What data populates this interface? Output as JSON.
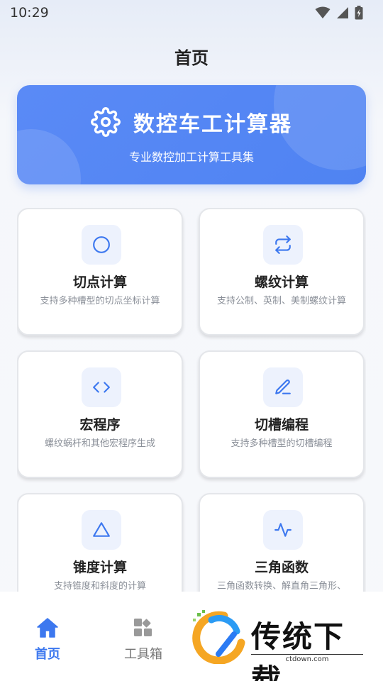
{
  "status": {
    "time": "10:29"
  },
  "header": {
    "title": "首页"
  },
  "banner": {
    "icon": "gear-icon",
    "title": "数控车工计算器",
    "subtitle": "专业数控加工计算工具集",
    "color": "#5585f4"
  },
  "cards": [
    {
      "icon": "circle-icon",
      "title": "切点计算",
      "desc": "支持多种槽型的切点坐标计算"
    },
    {
      "icon": "swap-arrows-icon",
      "title": "螺纹计算",
      "desc": "支持公制、英制、美制螺纹计算"
    },
    {
      "icon": "code-icon",
      "title": "宏程序",
      "desc": "螺纹蜗杆和其他宏程序生成"
    },
    {
      "icon": "pencil-icon",
      "title": "切槽编程",
      "desc": "支持多种槽型的切槽编程"
    },
    {
      "icon": "triangle-icon",
      "title": "锥度计算",
      "desc": "支持锥度和斜度的计算"
    },
    {
      "icon": "waveform-icon",
      "title": "三角函数",
      "desc": "三角函数转换、解直角三角形、"
    }
  ],
  "nav": {
    "home_label": "首页",
    "tools_label": "工具箱",
    "active_color": "#3d78ef"
  },
  "watermark": {
    "text": "传统下载",
    "url": "ctdown.com"
  }
}
